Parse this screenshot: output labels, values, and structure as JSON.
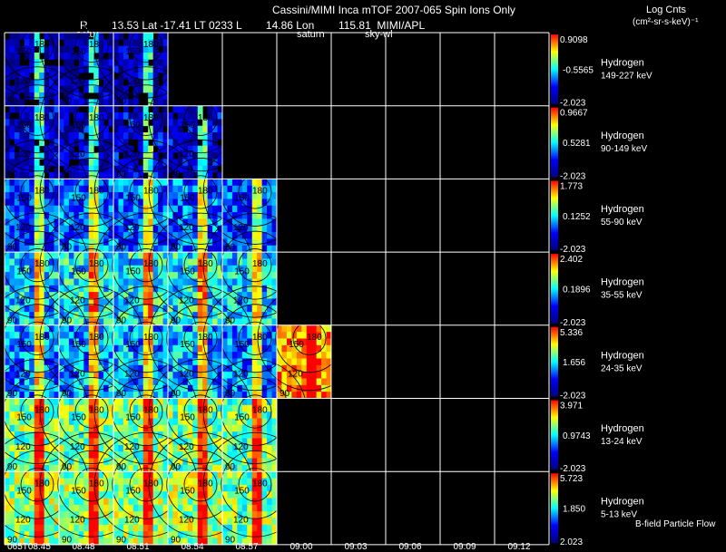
{
  "header": {
    "title": "Cassini/MIMI Inca mTOF  2007-065   Spin   Ions Only",
    "line2_r": "R",
    "line2_ephem": "13.53 Lat -17.41 LT 0233 L        14.86 Lon        115.81  MIMI/APL",
    "units_title": "Log Cnts",
    "units_sub": "(cm²-sr-s-keV)⁻¹"
  },
  "overlay_labels": {
    "sun": "satur",
    "saturn": "saturn",
    "skyward": "sky-wl"
  },
  "footer_note": "B-field Particle Flow",
  "chart_data": {
    "type": "heatmap",
    "x_tick_labels": [
      "065T08:45",
      "08:48",
      "08:51",
      "08:54",
      "08:57",
      "09:00",
      "09:03",
      "09:06",
      "09:09",
      "09:12"
    ],
    "contour_labels": [
      "180",
      "150",
      "120",
      "90"
    ],
    "colormap": [
      "#000080",
      "#0000ff",
      "#00ffff",
      "#ffff00",
      "#ff0000"
    ],
    "rows": [
      {
        "species": "Hydrogen",
        "range": "149-227 keV",
        "cmax": "0.9098",
        "cmid": "-0.5565",
        "cmin": "-2.023",
        "level": [
          0.15,
          0.15,
          0.15,
          null,
          null,
          null,
          null,
          null,
          null,
          null
        ]
      },
      {
        "species": "Hydrogen",
        "range": "90-149 keV",
        "cmax": "0.9667",
        "cmid": "0.5281",
        "cmin": "-2.023",
        "level": [
          0.2,
          0.2,
          0.2,
          0.2,
          null,
          null,
          null,
          null,
          null,
          null
        ]
      },
      {
        "species": "Hydrogen",
        "range": "55-90 keV",
        "cmax": "1.773",
        "cmid": "0.1252",
        "cmin": "-2.023",
        "level": [
          0.3,
          0.35,
          0.35,
          0.35,
          0.3,
          null,
          null,
          null,
          null,
          null
        ]
      },
      {
        "species": "Hydrogen",
        "range": "35-55 keV",
        "cmax": "2.402",
        "cmid": "0.1896",
        "cmin": "-2.023",
        "level": [
          0.45,
          0.5,
          0.5,
          0.5,
          0.45,
          null,
          null,
          null,
          null,
          null
        ]
      },
      {
        "species": "Hydrogen",
        "range": "24-35 keV",
        "cmax": "5.336",
        "cmid": "1.656",
        "cmin": "-2.023",
        "level": [
          0.4,
          0.42,
          0.42,
          0.42,
          0.38,
          0.85,
          null,
          null,
          null,
          null
        ]
      },
      {
        "species": "Hydrogen",
        "range": "13-24 keV",
        "cmax": "3.971",
        "cmid": "0.9743",
        "cmin": "-2.023",
        "level": [
          0.62,
          0.62,
          0.62,
          0.62,
          0.6,
          null,
          null,
          null,
          null,
          null
        ]
      },
      {
        "species": "Hydrogen",
        "range": "5-13 keV",
        "cmax": "5.723",
        "cmid": "1.850",
        "cmin": "2.023",
        "level": [
          0.65,
          0.65,
          0.65,
          0.65,
          0.62,
          null,
          null,
          null,
          null,
          null
        ]
      }
    ]
  }
}
